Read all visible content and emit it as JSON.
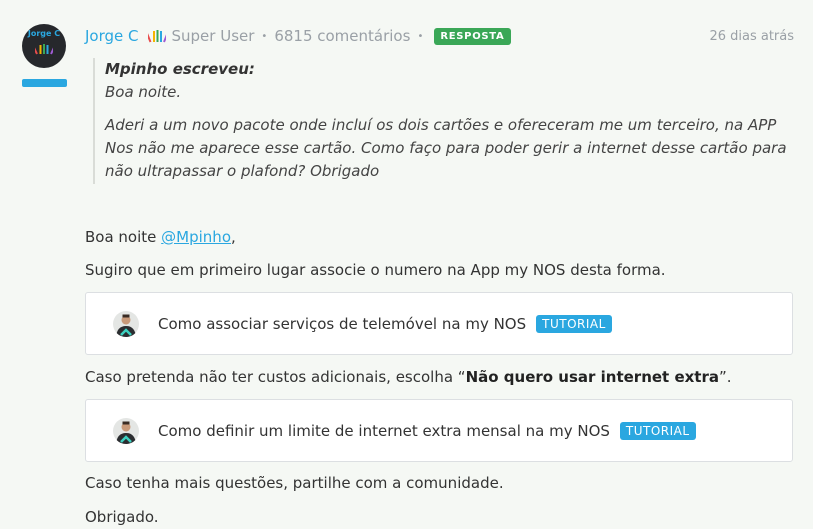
{
  "post": {
    "avatar_text": "Jorge C",
    "author": "Jorge C",
    "role": "Super User",
    "comments": "6815 comentários",
    "separator": "•",
    "badge": "RESPOSTA",
    "timestamp": "26 dias atrás"
  },
  "quote": {
    "author_line": "Mpinho escreveu:",
    "greeting": "Boa noite.",
    "body": "Aderi a um novo pacote onde incluí os dois cartões e ofereceram me um terceiro, na APP Nos não me aparece esse cartão. Como faço para poder gerir a internet desse cartão para não ultrapassar o plafond? Obrigado"
  },
  "body": {
    "greeting_prefix": "Boa noite ",
    "mention": "@Mpinho",
    "greeting_suffix": ",",
    "p1": "Sugiro que em primeiro lugar associe o numero na App my NOS desta forma.",
    "p2_prefix": "Caso pretenda não ter custos adicionais, escolha “",
    "p2_bold": "Não quero usar internet extra",
    "p2_suffix": "”.",
    "p3": "Caso tenha mais questões, partilhe com a comunidade.",
    "p4": "Obrigado."
  },
  "tutorials": [
    {
      "title": "Como associar serviços de telemóvel na my NOS",
      "tag": "TUTORIAL"
    },
    {
      "title": "Como definir um limite de internet extra mensal na my NOS",
      "tag": "TUTORIAL"
    }
  ],
  "colors": {
    "accent": "#2aa7e0",
    "badge_green": "#3aa757",
    "background": "#f5f8f4"
  }
}
